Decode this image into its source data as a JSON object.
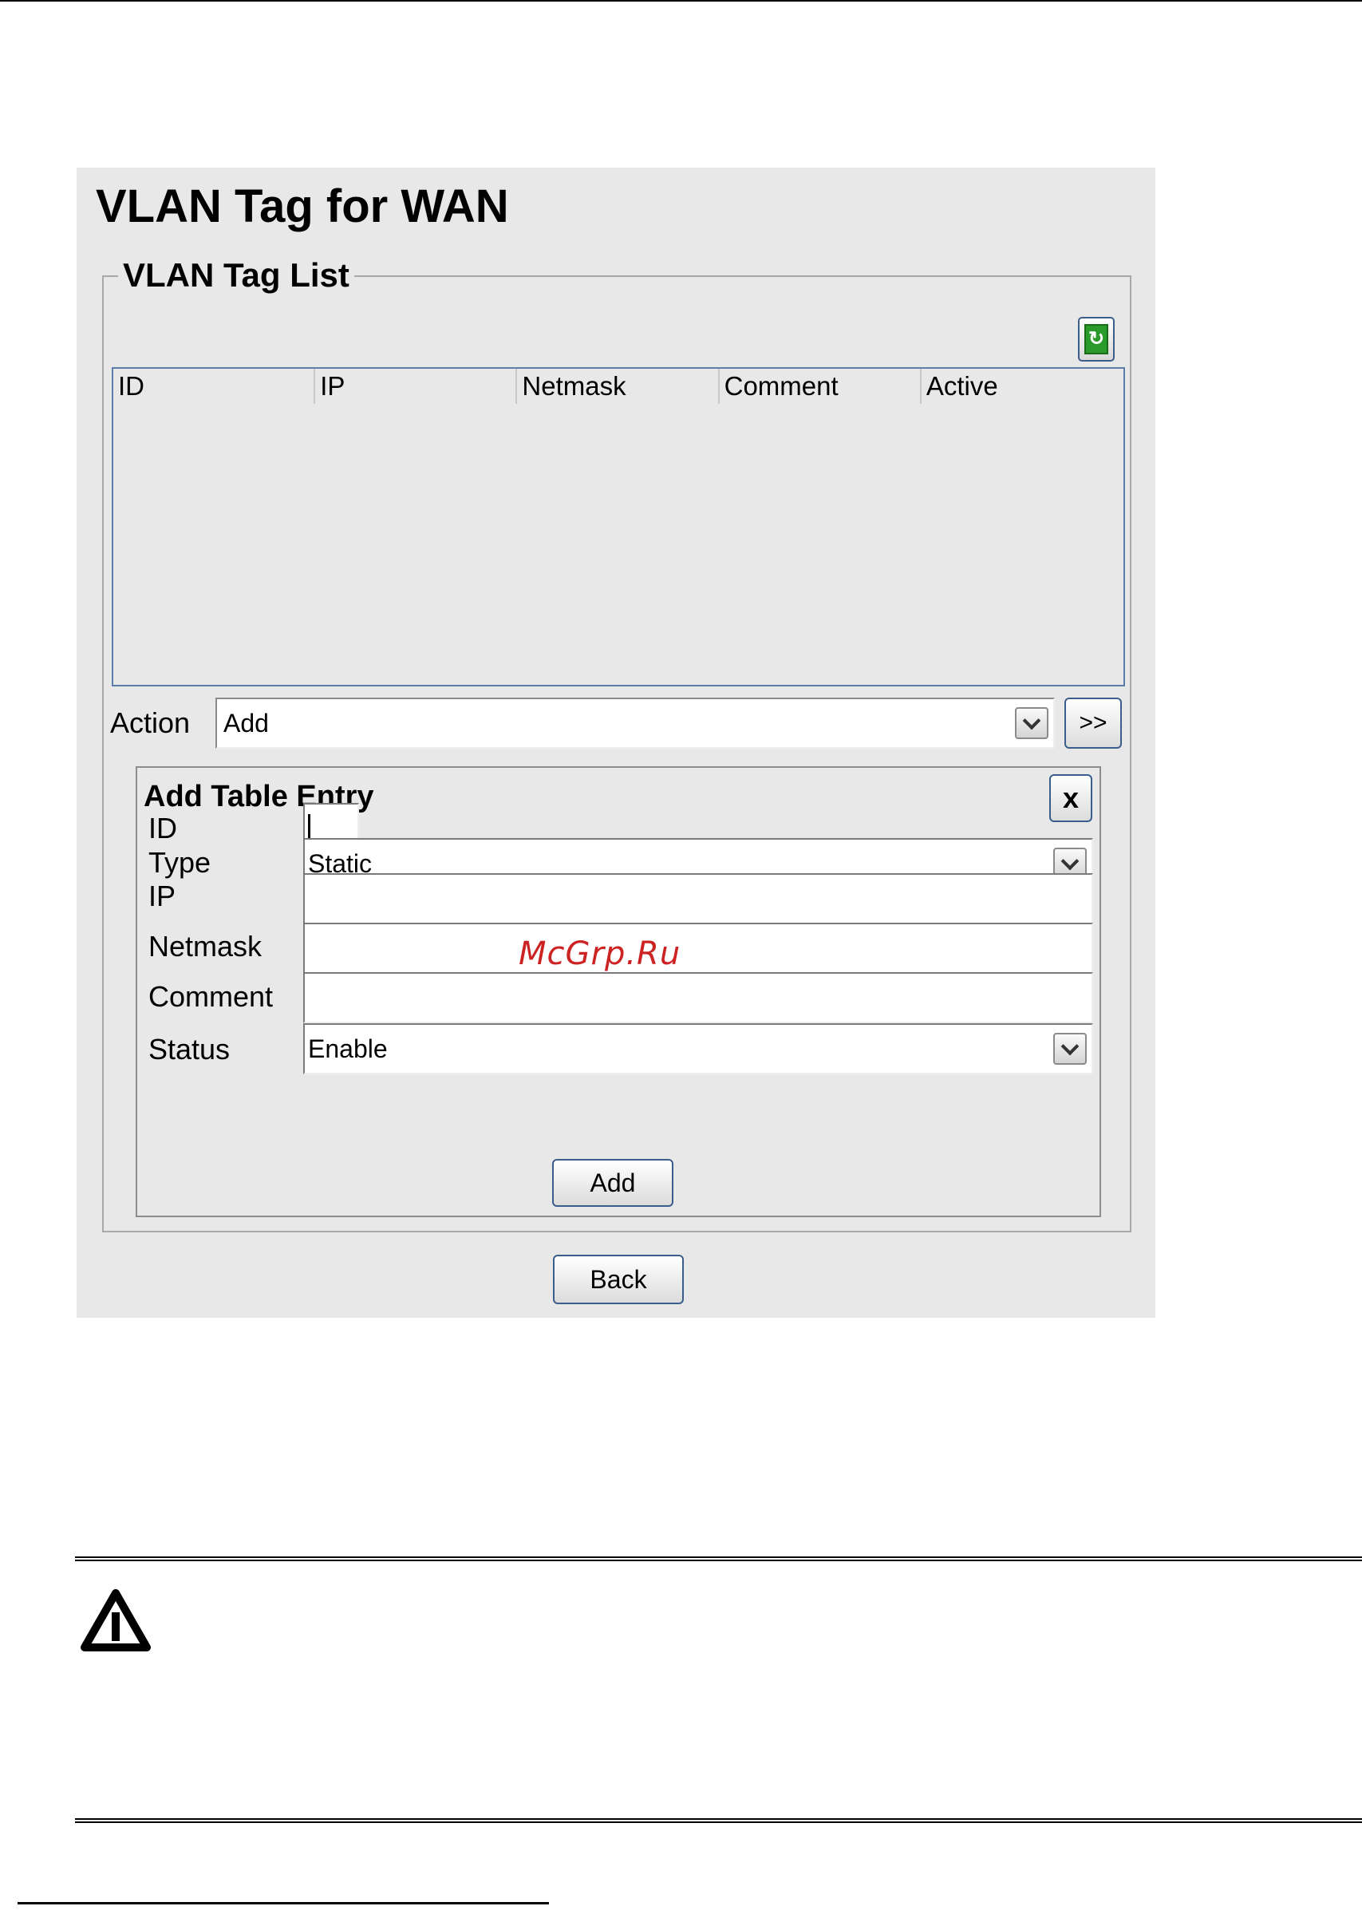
{
  "page": {
    "title": "VLAN Tag for WAN",
    "watermark": "McGrp.Ru"
  },
  "list": {
    "legend": "VLAN Tag List",
    "columns": [
      "ID",
      "IP",
      "Netmask",
      "Comment",
      "Active"
    ],
    "rows": []
  },
  "action": {
    "label": "Action",
    "selected": "Add",
    "go_label": ">>"
  },
  "entry": {
    "title": "Add Table Entry",
    "close_label": "x",
    "fields": {
      "id_label": "ID",
      "id_value": "",
      "type_label": "Type",
      "type_value": "Static",
      "ip_label": "IP",
      "ip_value": "",
      "netmask_label": "Netmask",
      "netmask_value": "",
      "comment_label": "Comment",
      "comment_value": "",
      "status_label": "Status",
      "status_value": "Enable"
    },
    "add_label": "Add"
  },
  "back_label": "Back",
  "icons": {
    "refresh": "refresh-icon",
    "warning": "warning-icon"
  },
  "colors": {
    "panel_bg": "#e8e8e8",
    "button_border": "#3a5d8a",
    "refresh_green": "#2a9a2a",
    "watermark_red": "#cc2222"
  }
}
